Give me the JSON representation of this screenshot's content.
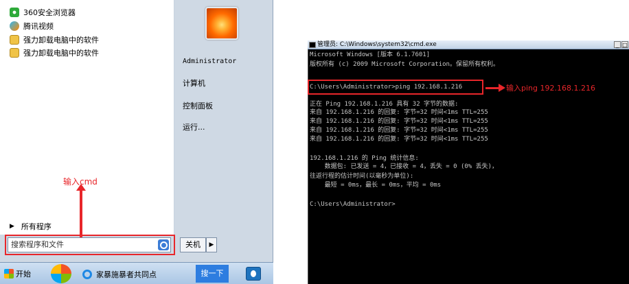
{
  "start_menu": {
    "programs": [
      {
        "label": "360安全浏览器",
        "icon": "360-browser-icon"
      },
      {
        "label": "腾讯视频",
        "icon": "tencent-video-icon"
      },
      {
        "label": "强力卸载电脑中的软件",
        "icon": "uninstall-icon"
      },
      {
        "label": "强力卸载电脑中的软件",
        "icon": "uninstall-icon"
      }
    ],
    "all_programs": "所有程序",
    "search_placeholder": "搜索程序和文件",
    "user_name": "Administrator",
    "right_links": [
      "计算机",
      "控制面板",
      "运行..."
    ],
    "shutdown_label": "关机",
    "annotation": "输入cmd"
  },
  "taskbar": {
    "start_label": "开始",
    "ie_label": "家暴施暴者共同点",
    "search_button": "搜一下"
  },
  "cmd": {
    "title": "管理员: C:\\Windows\\system32\\cmd.exe",
    "lines": [
      "Microsoft Windows [版本 6.1.7601]",
      "版权所有 (c) 2009 Microsoft Corporation。保留所有权利。",
      "",
      "C:\\Users\\Administrator>ping 192.168.1.216",
      "",
      "正在 Ping 192.168.1.216 具有 32 字节的数据:",
      "来自 192.168.1.216 的回复: 字节=32 时间<1ms TTL=255",
      "来自 192.168.1.216 的回复: 字节=32 时间<1ms TTL=255",
      "来自 192.168.1.216 的回复: 字节=32 时间<1ms TTL=255",
      "来自 192.168.1.216 的回复: 字节=32 时间<1ms TTL=255",
      "",
      "192.168.1.216 的 Ping 统计信息:",
      "    数据包: 已发送 = 4，已接收 = 4，丢失 = 0 (0% 丢失)，",
      "往返行程的估计时间(以毫秒为单位):",
      "    最短 = 0ms，最长 = 0ms，平均 = 0ms",
      "",
      "C:\\Users\\Administrator>"
    ],
    "annotation": "输入ping 192.168.1.216"
  },
  "colors": {
    "annotation_red": "#e8262a"
  }
}
